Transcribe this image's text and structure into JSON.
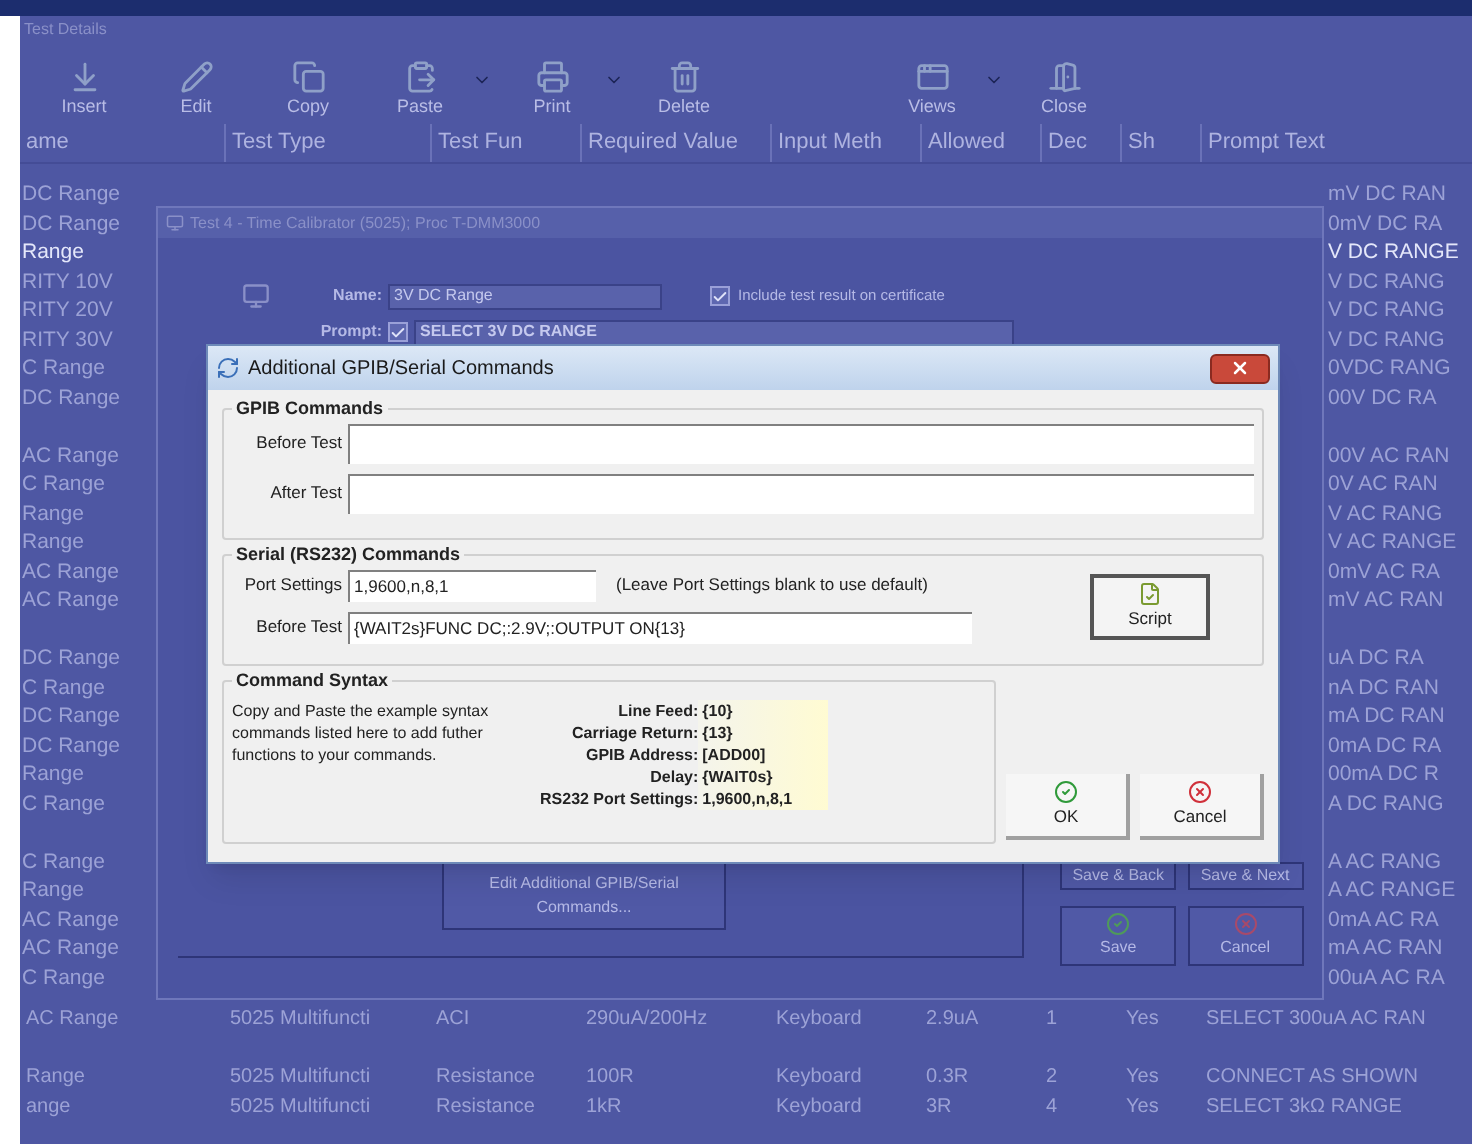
{
  "window": {
    "title": "Test Details"
  },
  "toolbar": [
    {
      "label": "Insert",
      "kind": "insert",
      "dropdown": false
    },
    {
      "label": "Edit",
      "kind": "edit",
      "dropdown": false
    },
    {
      "label": "Copy",
      "kind": "copy",
      "dropdown": false
    },
    {
      "label": "Paste",
      "kind": "paste",
      "dropdown": true
    },
    {
      "label": "Print",
      "kind": "print",
      "dropdown": true
    },
    {
      "label": "Delete",
      "kind": "delete",
      "dropdown": false
    },
    {
      "label": "Views",
      "kind": "views",
      "dropdown": true
    },
    {
      "label": "Close",
      "kind": "close",
      "dropdown": false
    }
  ],
  "table": {
    "columns": [
      "ame",
      "Test Type",
      "Test Fun",
      "Required Value",
      "Input Meth",
      "Allowed",
      "Dec",
      "Sh",
      "Prompt Text"
    ],
    "left_groups": [
      [
        {
          "text": "DC Range",
          "selected": false
        },
        {
          "text": "DC Range",
          "selected": false
        },
        {
          "text": "Range",
          "selected": true
        },
        {
          "text": "RITY 10V",
          "selected": false
        },
        {
          "text": "RITY 20V",
          "selected": false
        },
        {
          "text": "RITY 30V",
          "selected": false
        },
        {
          "text": "C Range",
          "selected": false
        },
        {
          "text": "DC Range",
          "selected": false
        }
      ],
      [
        {
          "text": "AC Range",
          "selected": false
        },
        {
          "text": "C Range",
          "selected": false
        },
        {
          "text": "Range",
          "selected": false
        },
        {
          "text": "Range",
          "selected": false
        },
        {
          "text": "AC Range",
          "selected": false
        },
        {
          "text": "AC Range",
          "selected": false
        }
      ],
      [
        {
          "text": "DC Range",
          "selected": false
        },
        {
          "text": "C Range",
          "selected": false
        },
        {
          "text": "DC Range",
          "selected": false
        },
        {
          "text": "DC Range",
          "selected": false
        },
        {
          "text": "Range",
          "selected": false
        },
        {
          "text": "C Range",
          "selected": false
        }
      ],
      [
        {
          "text": "C Range",
          "selected": false
        },
        {
          "text": "Range",
          "selected": false
        },
        {
          "text": "AC Range",
          "selected": false
        },
        {
          "text": "AC Range",
          "selected": false
        },
        {
          "text": "C Range",
          "selected": false
        }
      ]
    ],
    "right_groups": [
      [
        {
          "text": "mV DC RAN",
          "selected": false
        },
        {
          "text": "0mV DC RA",
          "selected": false
        },
        {
          "text": "V DC RANGE",
          "selected": true
        },
        {
          "text": "V DC RANG",
          "selected": false
        },
        {
          "text": "V DC RANG",
          "selected": false
        },
        {
          "text": "V DC RANG",
          "selected": false
        },
        {
          "text": "0VDC RANG",
          "selected": false
        },
        {
          "text": "00V DC RA",
          "selected": false
        }
      ],
      [
        {
          "text": "00V AC RAN",
          "selected": false
        },
        {
          "text": "0V AC RAN",
          "selected": false
        },
        {
          "text": "V AC RANG",
          "selected": false
        },
        {
          "text": "V AC RANGE",
          "selected": false
        },
        {
          "text": "0mV AC RA",
          "selected": false
        },
        {
          "text": "mV AC RAN",
          "selected": false
        }
      ],
      [
        {
          "text": "uA DC RA",
          "selected": false
        },
        {
          "text": "nA DC RAN",
          "selected": false
        },
        {
          "text": "mA DC RAN",
          "selected": false
        },
        {
          "text": "0mA DC RA",
          "selected": false
        },
        {
          "text": "00mA DC R",
          "selected": false
        },
        {
          "text": "A DC RANG",
          "selected": false
        }
      ],
      [
        {
          "text": "A AC RANG",
          "selected": false
        },
        {
          "text": "A AC RANGE",
          "selected": false
        },
        {
          "text": "0mA AC RA",
          "selected": false
        },
        {
          "text": "mA AC RAN",
          "selected": false
        },
        {
          "text": "00uA AC RA",
          "selected": false
        }
      ]
    ],
    "rows": [
      {
        "cells": [
          "AC Range",
          "5025 Multifuncti",
          "ACI",
          "290uA/200Hz",
          "Keyboard",
          "2.9uA",
          "1",
          "Yes",
          "SELECT 300uA AC RAN"
        ]
      },
      {
        "cells": [
          "Range",
          "5025 Multifuncti",
          "Resistance",
          "100R",
          "Keyboard",
          "0.3R",
          "2",
          "Yes",
          "CONNECT AS SHOWN"
        ]
      },
      {
        "cells": [
          "ange",
          "5025 Multifuncti",
          "Resistance",
          "1kR",
          "Keyboard",
          "3R",
          "4",
          "Yes",
          "SELECT 3kΩ RANGE"
        ]
      }
    ]
  },
  "test_window": {
    "title": "Test 4 - Time Calibrator (5025); Proc T-DMM3000",
    "name_label": "Name:",
    "name": "3V DC Range",
    "certificate": {
      "label": "Include test result on certificate",
      "checked": true
    },
    "prompt_label": "Prompt:",
    "prompt_checked": true,
    "prompt": "SELECT 3V DC RANGE",
    "edit_button": "Edit Additional GPIB/Serial Commands...",
    "buttons": [
      {
        "label": "Save & Back",
        "kind": "plain"
      },
      {
        "label": "Save & Next",
        "kind": "plain"
      },
      {
        "label": "Save",
        "kind": "save"
      },
      {
        "label": "Cancel",
        "kind": "cancel"
      }
    ]
  },
  "dialog": {
    "title": "Additional GPIB/Serial Commands",
    "gpib": {
      "title": "GPIB Commands",
      "fields": [
        {
          "label": "Before Test"
        },
        {
          "label": "After Test"
        }
      ]
    },
    "serial": {
      "title": "Serial (RS232) Commands",
      "port_label": "Port Settings",
      "port_value": "1,9600,n,8,1",
      "port_hint": "(Leave Port Settings blank to use default)",
      "before_label": "Before Test",
      "before_value": "{WAIT2s}FUNC DC;:2.9V;:OUTPUT ON{13}",
      "script_button": "Script"
    },
    "syntax": {
      "title": "Command Syntax",
      "text": "Copy and Paste the example syntax commands listed here to add futher functions to your commands.",
      "entries": [
        {
          "label": "Line Feed:",
          "value": "{10}"
        },
        {
          "label": "Carriage Return:",
          "value": "{13}"
        },
        {
          "label": "GPIB Address:",
          "value": "[ADD00]"
        },
        {
          "label": "Delay:",
          "value": "{WAIT0s}"
        },
        {
          "label": "RS232 Port Settings:",
          "value": "1,9600,n,8,1"
        }
      ]
    },
    "buttons": [
      {
        "label": "OK",
        "kind": "ok"
      },
      {
        "label": "Cancel",
        "kind": "cancel"
      }
    ]
  }
}
